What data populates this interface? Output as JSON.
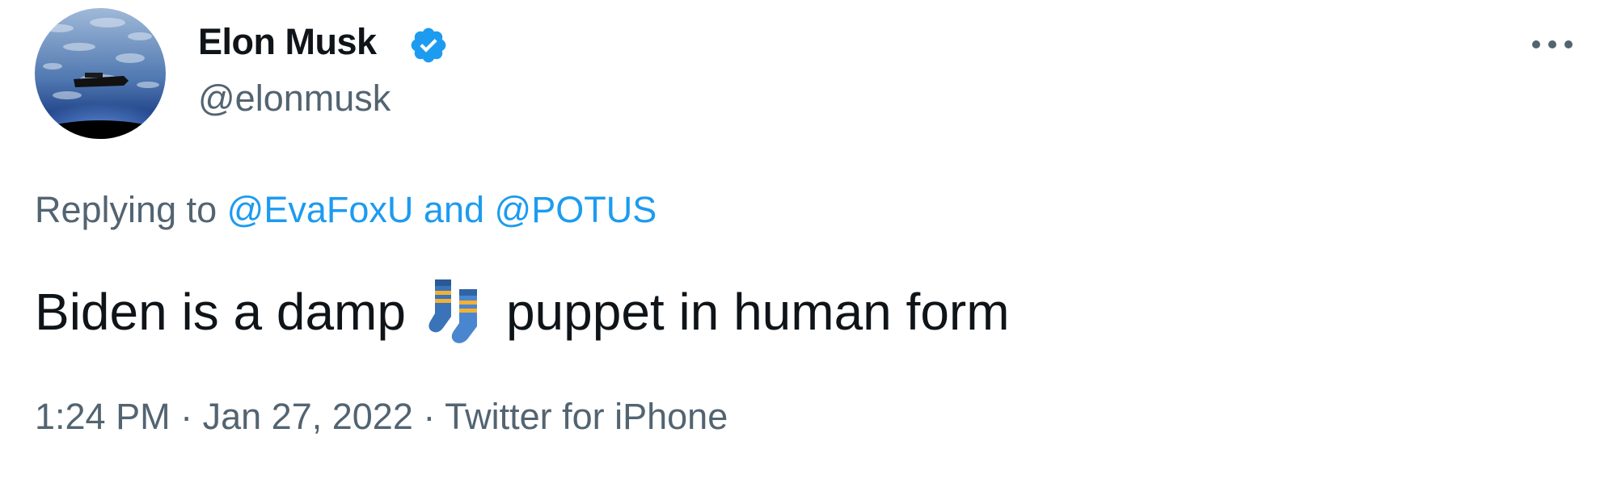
{
  "author": {
    "display_name": "Elon Musk",
    "handle": "@elonmusk",
    "verified": true,
    "verified_color": "#1d9bf0"
  },
  "reply": {
    "prefix": "Replying to",
    "mention_1": "@EvaFoxU",
    "joiner": "and",
    "mention_2": "@POTUS",
    "link_color": "#1d9bf0"
  },
  "tweet": {
    "text_before": "Biden is a damp",
    "emoji": "socks-emoji",
    "text_after": "puppet in human form"
  },
  "meta": {
    "time": "1:24 PM",
    "sep1": "·",
    "date": "Jan 27, 2022",
    "sep2": "·",
    "source": "Twitter for iPhone"
  },
  "icons": {
    "more": "more-horizontal-icon",
    "verified": "verified-badge-icon"
  },
  "colors": {
    "primary_text": "#0f1419",
    "secondary_text": "#536471"
  }
}
